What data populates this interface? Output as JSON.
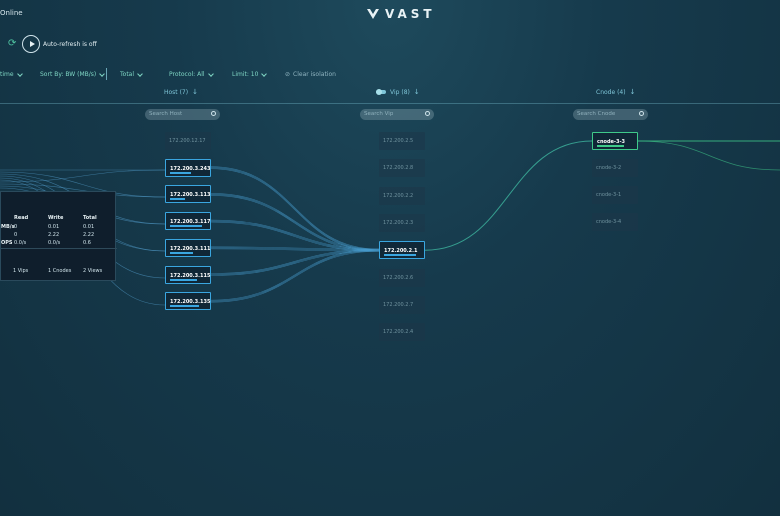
{
  "header": {
    "status": "Online",
    "logo": "VAST",
    "auto_refresh": "Auto-refresh is off"
  },
  "filters": {
    "time": "time",
    "sort": "Sort By: BW (MB/s)",
    "total": "Total",
    "protocol": "Protocol: All",
    "limit": "Limit: 10",
    "clear": "Clear isolation"
  },
  "columns": {
    "host": {
      "title": "Host (7)",
      "search": "Search Host"
    },
    "vip": {
      "title": "Vip (8)",
      "search": "Search Vip"
    },
    "cnode": {
      "title": "Cnode (4)",
      "search": "Search Cnode"
    }
  },
  "hosts": [
    {
      "label": "172.200.12.17",
      "active": false,
      "level": 0
    },
    {
      "label": "172.200.3.243",
      "active": true,
      "level": 0.55
    },
    {
      "label": "172.200.3.113",
      "active": true,
      "level": 0.4
    },
    {
      "label": "172.200.3.117",
      "active": true,
      "level": 0.85
    },
    {
      "label": "172.200.3.111",
      "active": true,
      "level": 0.6
    },
    {
      "label": "172.200.3.115",
      "active": true,
      "level": 0.7
    },
    {
      "label": "172.200.3.135",
      "active": true,
      "level": 0.75
    }
  ],
  "vips": [
    {
      "label": "172.200.2.5",
      "active": false,
      "level": 0
    },
    {
      "label": "172.200.2.8",
      "active": false,
      "level": 0
    },
    {
      "label": "172.200.2.2",
      "active": false,
      "level": 0
    },
    {
      "label": "172.200.2.3",
      "active": false,
      "level": 0
    },
    {
      "label": "172.200.2.1",
      "active": true,
      "level": 0.85
    },
    {
      "label": "172.200.2.6",
      "active": false,
      "level": 0
    },
    {
      "label": "172.200.2.7",
      "active": false,
      "level": 0
    },
    {
      "label": "172.200.2.4",
      "active": false,
      "level": 0
    }
  ],
  "cnodes": [
    {
      "label": "cnode-3-3",
      "active": true,
      "level": 0.7
    },
    {
      "label": "cnode-3-2",
      "active": false,
      "level": 0
    },
    {
      "label": "cnode-3-1",
      "active": false,
      "level": 0
    },
    {
      "label": "cnode-3-4",
      "active": false,
      "level": 0
    }
  ],
  "tooltip": {
    "headers": [
      "Read",
      "Write",
      "Total"
    ],
    "rows": [
      {
        "label": "MB/s",
        "values": [
          "0",
          "0.01",
          "0.01"
        ]
      },
      {
        "label": "",
        "values": [
          "0",
          "2.22",
          "2.22"
        ]
      },
      {
        "label": "OPS",
        "values": [
          "0.0/s",
          "0.0/s",
          "0.6"
        ]
      }
    ],
    "summary": [
      "1 Vips",
      "1 Cnodes",
      "2 Views"
    ]
  },
  "colors": {
    "accent_blue": "#3aa6e0",
    "accent_green": "#3fc98a",
    "filter_text": "#7fd6c4"
  }
}
